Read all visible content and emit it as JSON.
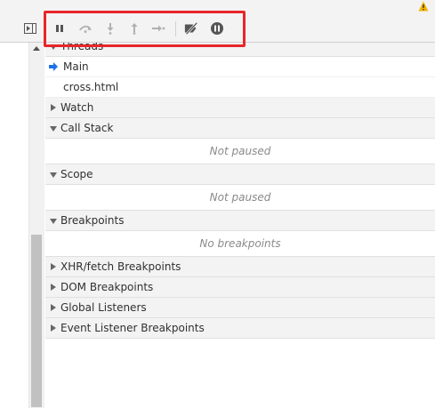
{
  "window": {
    "warning_icon": "warning-icon"
  },
  "navigator": {
    "toggle_icon": "toggle-navigator-icon"
  },
  "toolbar": {
    "buttons": [
      {
        "name": "pause-resume-button",
        "icon": "pause-icon",
        "enabled": true
      },
      {
        "name": "step-over-button",
        "icon": "step-over-icon",
        "enabled": false
      },
      {
        "name": "step-into-button",
        "icon": "step-into-icon",
        "enabled": false
      },
      {
        "name": "step-out-button",
        "icon": "step-out-icon",
        "enabled": false
      },
      {
        "name": "step-button",
        "icon": "step-icon",
        "enabled": false
      },
      {
        "name": "deactivate-breakpoints-button",
        "icon": "breakpoints-off-icon",
        "enabled": true
      },
      {
        "name": "pause-on-exceptions-button",
        "icon": "pause-on-exceptions-icon",
        "enabled": true
      }
    ],
    "highlight_color": "#e8262b"
  },
  "sections": {
    "threads": {
      "label": "Threads",
      "items": [
        "Main",
        "cross.html"
      ]
    },
    "watch": {
      "label": "Watch"
    },
    "call_stack": {
      "label": "Call Stack",
      "placeholder": "Not paused"
    },
    "scope": {
      "label": "Scope",
      "placeholder": "Not paused"
    },
    "breakpoints": {
      "label": "Breakpoints",
      "placeholder": "No breakpoints"
    },
    "xhr": {
      "label": "XHR/fetch Breakpoints"
    },
    "dom": {
      "label": "DOM Breakpoints"
    },
    "global": {
      "label": "Global Listeners"
    },
    "event": {
      "label": "Event Listener Breakpoints"
    }
  },
  "colors": {
    "accent": "#1a73e8",
    "warning": "#f4b400"
  }
}
